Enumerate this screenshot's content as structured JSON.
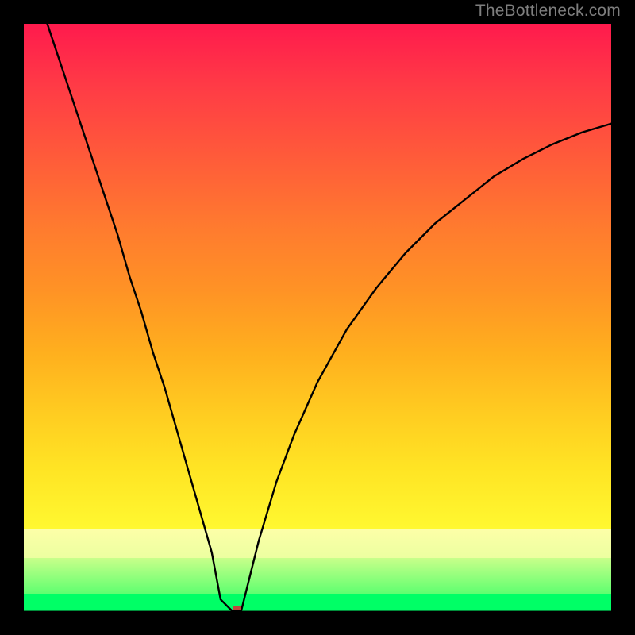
{
  "watermark": "TheBottleneck.com",
  "chart_data": {
    "type": "line",
    "title": "",
    "xlabel": "",
    "ylabel": "",
    "xlim": [
      0,
      100
    ],
    "ylim": [
      0,
      100
    ],
    "background_bands": [
      {
        "name": "gradient-red-to-yellow",
        "from": 14,
        "to": 100
      },
      {
        "name": "pale-yellow",
        "from": 9,
        "to": 14
      },
      {
        "name": "mid-green",
        "from": 3,
        "to": 9
      },
      {
        "name": "green",
        "from": 0,
        "to": 3
      }
    ],
    "series": [
      {
        "name": "bottleneck-curve",
        "x": [
          4,
          6,
          8,
          10,
          12,
          14,
          16,
          18,
          20,
          22,
          24,
          26,
          28,
          30,
          32,
          33.5,
          35.5,
          37,
          38,
          40,
          43,
          46,
          50,
          55,
          60,
          65,
          70,
          75,
          80,
          85,
          90,
          95,
          100
        ],
        "values": [
          100,
          94,
          88,
          82,
          76,
          70,
          64,
          57,
          51,
          44,
          38,
          31,
          24,
          17,
          10,
          2,
          0,
          0,
          4,
          12,
          22,
          30,
          39,
          48,
          55,
          61,
          66,
          70,
          74,
          77,
          79.5,
          81.5,
          83
        ]
      }
    ],
    "marker": {
      "x": 36.3,
      "y": 0.4,
      "color": "#c2463d"
    }
  }
}
